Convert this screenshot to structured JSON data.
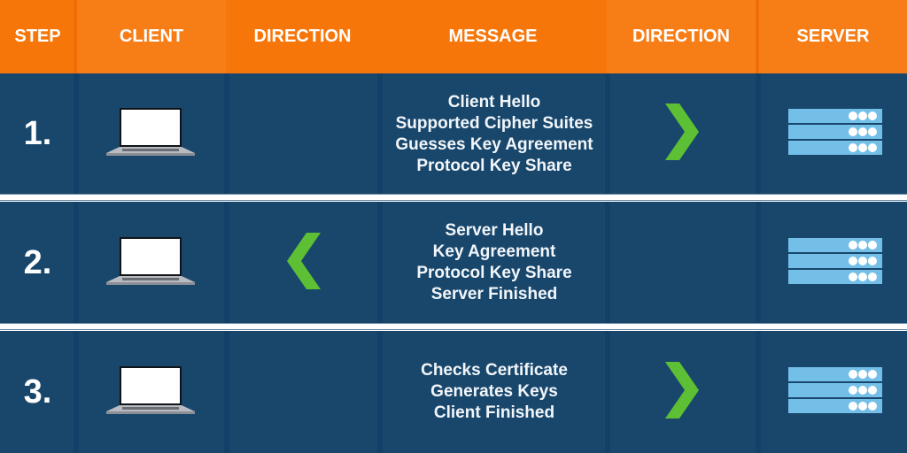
{
  "header": {
    "columns": [
      "STEP",
      "CLIENT",
      "DIRECTION",
      "MESSAGE",
      "DIRECTION",
      "SERVER"
    ]
  },
  "colors": {
    "header_bg": "#f7760a",
    "row_bg": "#19476c",
    "arrow": "#5dbf34",
    "server": "#73bfe8"
  },
  "rows": [
    {
      "step": "1.",
      "client_icon": "laptop-icon",
      "direction": "client-to-server",
      "message": [
        "Client Hello",
        "Supported Cipher Suites",
        "Guesses Key Agreement",
        "Protocol Key Share"
      ],
      "server_icon": "server-icon"
    },
    {
      "step": "2.",
      "client_icon": "laptop-icon",
      "direction": "server-to-client",
      "message": [
        "Server Hello",
        "Key Agreement",
        "Protocol Key Share",
        "Server Finished"
      ],
      "server_icon": "server-icon"
    },
    {
      "step": "3.",
      "client_icon": "laptop-icon",
      "direction": "client-to-server",
      "message": [
        "Checks Certificate",
        "Generates Keys",
        "Client Finished"
      ],
      "server_icon": "server-icon"
    }
  ]
}
